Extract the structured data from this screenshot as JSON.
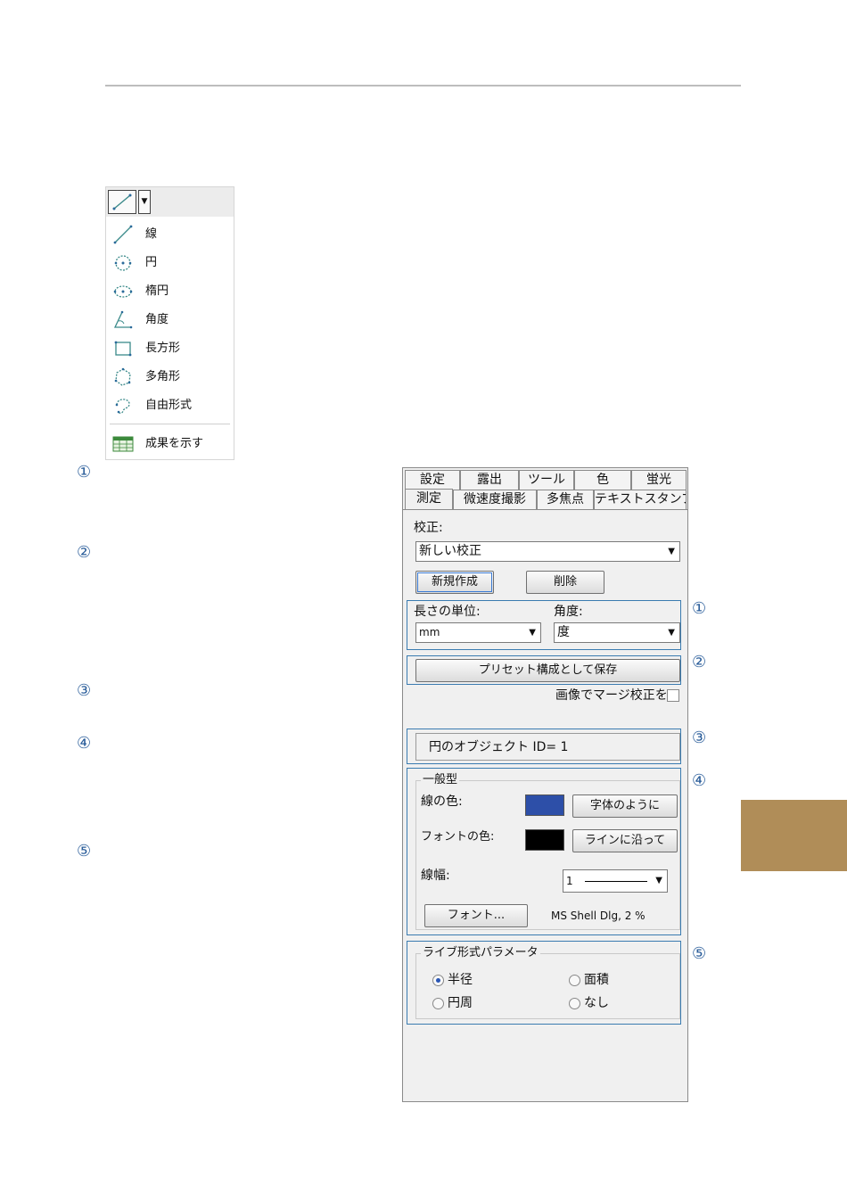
{
  "menu": {
    "items": [
      {
        "label": "線",
        "icon": "line-tool-icon"
      },
      {
        "label": "円",
        "icon": "circle-tool-icon"
      },
      {
        "label": "楕円",
        "icon": "ellipse-tool-icon"
      },
      {
        "label": "角度",
        "icon": "angle-tool-icon"
      },
      {
        "label": "長方形",
        "icon": "rectangle-tool-icon"
      },
      {
        "label": "多角形",
        "icon": "polygon-tool-icon"
      },
      {
        "label": "自由形式",
        "icon": "freeform-tool-icon"
      }
    ],
    "results_label": "成果を示す"
  },
  "callouts": [
    "①",
    "②",
    "③",
    "④",
    "⑤"
  ],
  "panel": {
    "tabs_row1": [
      "設定",
      "露出",
      "ツール",
      "色",
      "蛍光"
    ],
    "tabs_row2": [
      "測定",
      "微速度撮影",
      "多焦点",
      "テキストスタンプ"
    ],
    "calibration_label": "校正:",
    "calibration_value": "新しい校正",
    "new_button": "新規作成",
    "delete_button": "削除",
    "length_unit_label": "長さの単位:",
    "length_unit_value": "mm",
    "angle_label": "角度:",
    "angle_value": "度",
    "save_preset_button": "プリセット構成として保存",
    "merge_calibration_label": "画像でマージ校正を",
    "object_id_text": "円のオブジェクト  ID=  1",
    "general_group": "一般型",
    "line_color_label": "線の色:",
    "line_color": "#2d4fa8",
    "same_as_text_button": "字体のように",
    "font_color_label": "フォントの色:",
    "font_color": "#000000",
    "along_line_button": "ラインに沿って",
    "line_width_label": "線幅:",
    "line_width_value": "1",
    "font_button": "フォント...",
    "font_info": "MS Shell Dlg, 2 %",
    "live_params_group": "ライブ形式パラメータ",
    "radio_radius": "半径",
    "radio_area": "面積",
    "radio_perimeter": "円周",
    "radio_none": "なし"
  }
}
